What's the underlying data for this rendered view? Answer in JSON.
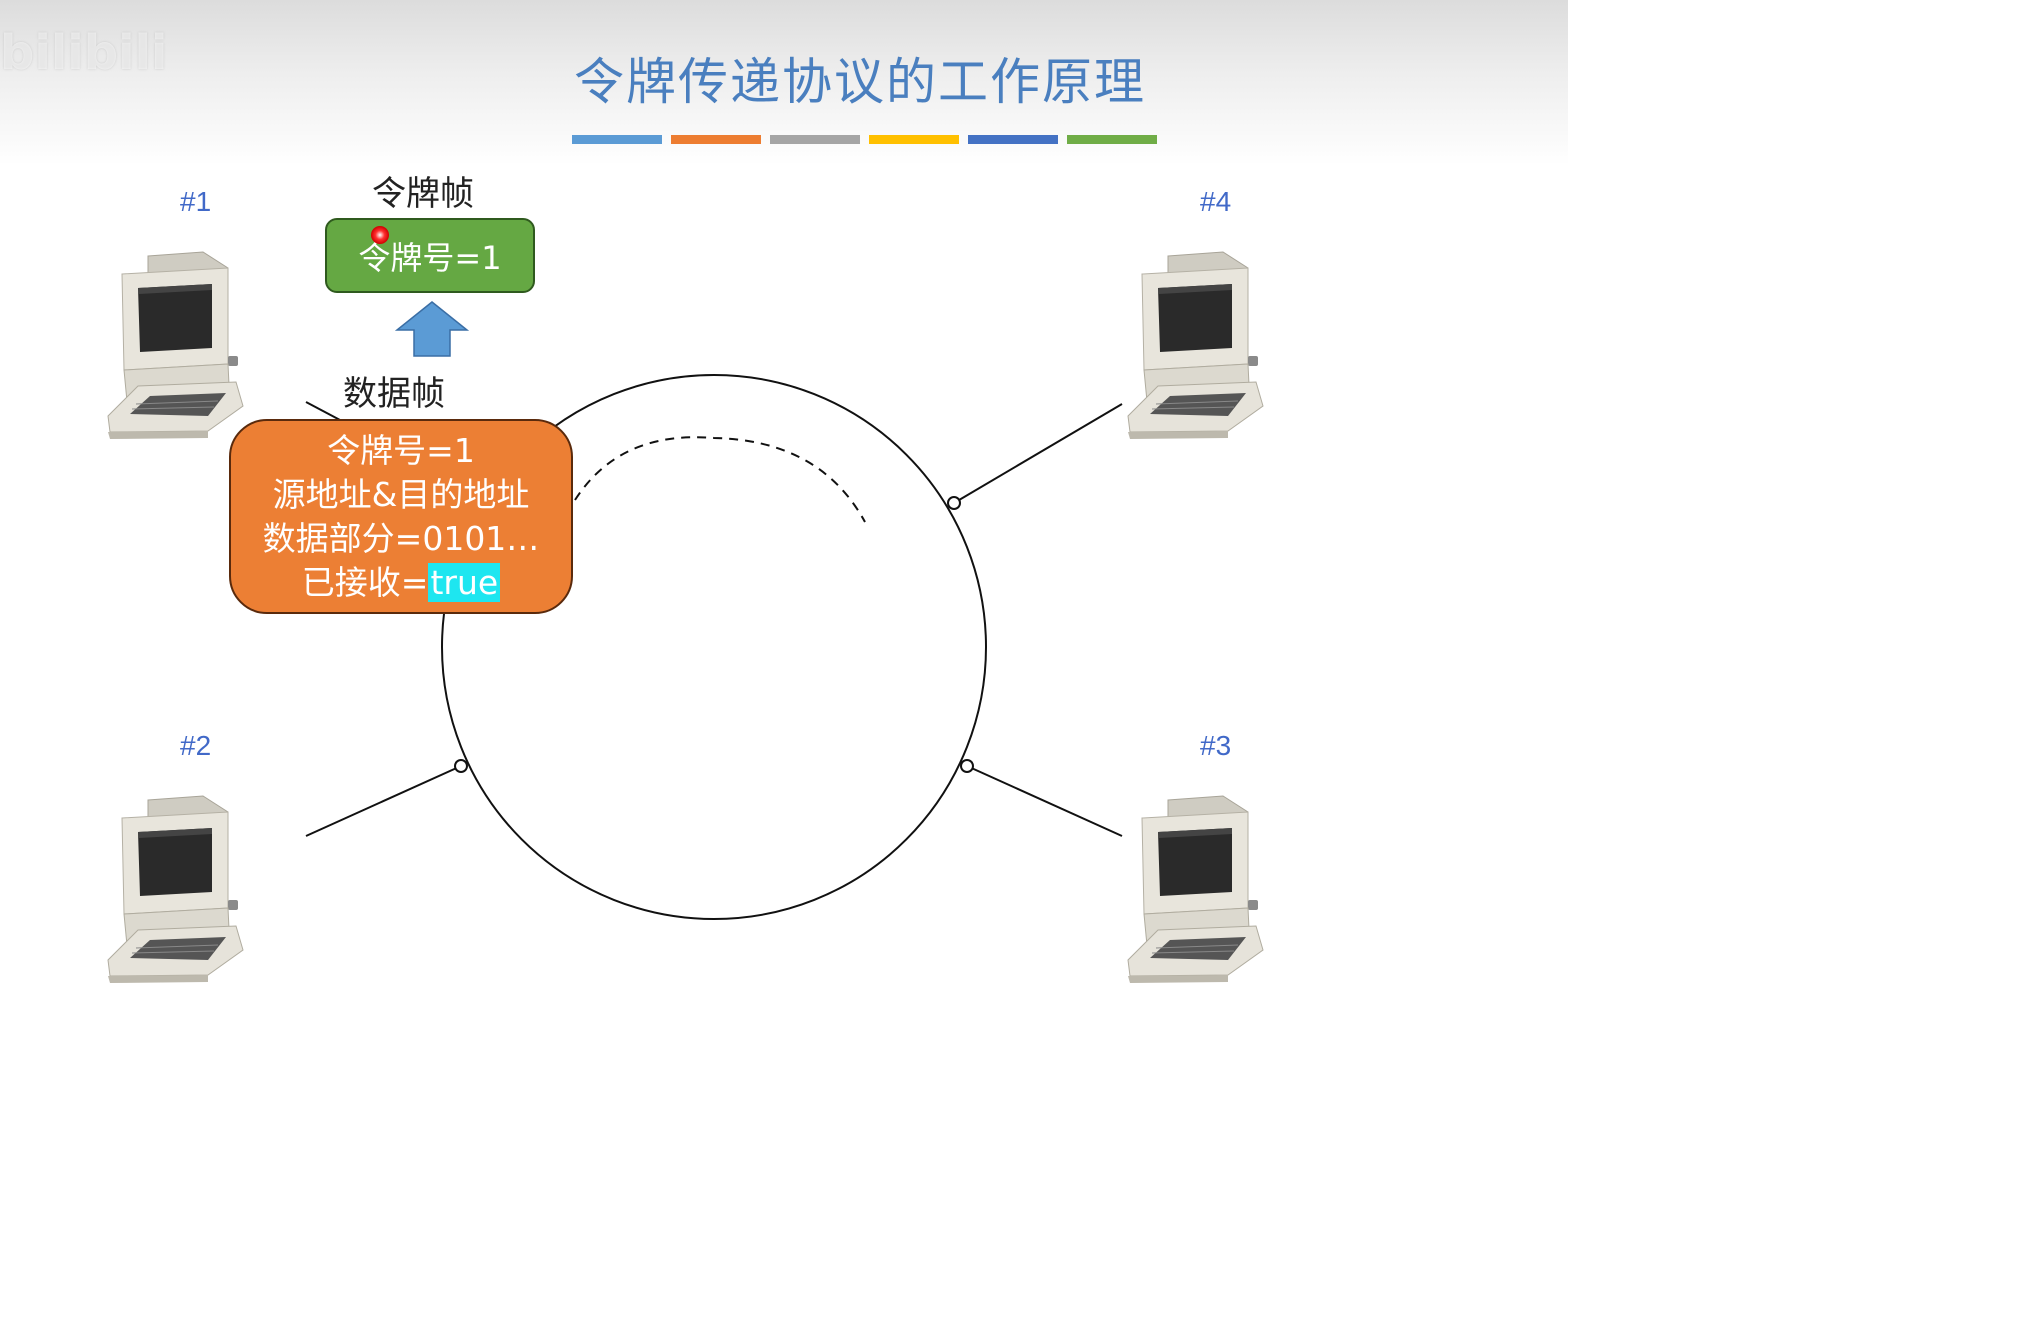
{
  "header": {
    "title": "令牌传递协议的工作原理",
    "watermark": "bilibili",
    "accent_bars": [
      "#5b9bd5",
      "#ed7d31",
      "#a5a5a5",
      "#ffc000",
      "#4472c4",
      "#70ad47"
    ]
  },
  "stations": [
    {
      "label": "#1"
    },
    {
      "label": "#2"
    },
    {
      "label": "#3"
    },
    {
      "label": "#4"
    }
  ],
  "token_frame": {
    "caption": "令牌帧",
    "content": "令牌号=1",
    "color": "#65a843"
  },
  "data_frame": {
    "caption": "数据帧",
    "lines": [
      "令牌号=1",
      "源地址&目的地址",
      "数据部分=0101…"
    ],
    "ack_label": "已接收=",
    "ack_value": "true",
    "color": "#ec7f34",
    "highlight_color": "#1ee6f0"
  },
  "arrow": {
    "direction": "up",
    "color": "#5b9bd5"
  },
  "icons": {
    "station": "computer-icon",
    "pointer": "laser-pointer-dot"
  }
}
